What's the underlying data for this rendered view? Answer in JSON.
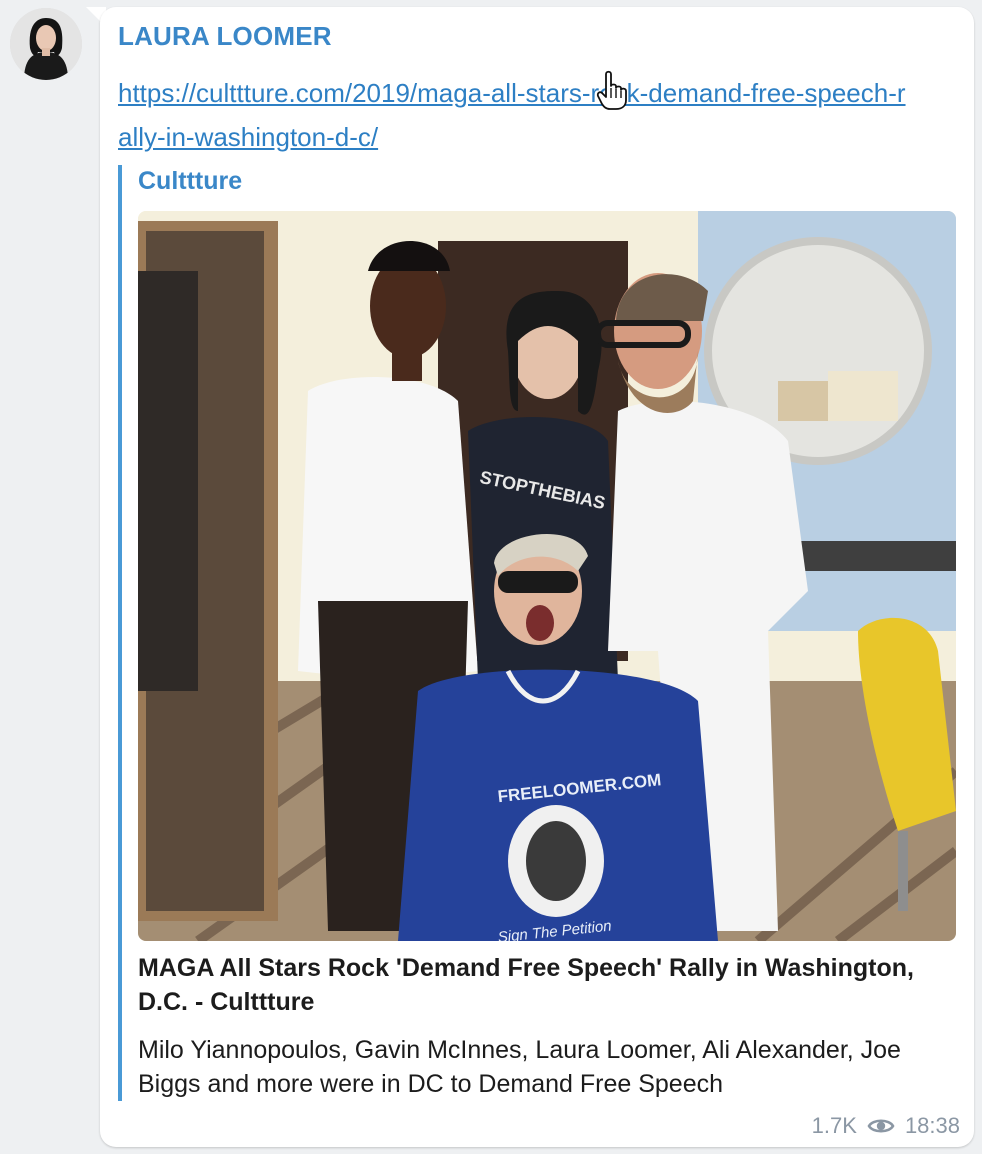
{
  "message": {
    "sender": "LAURA LOOMER",
    "link": "https://culttture.com/2019/maga-all-stars-rock-demand-free-speech-rally-in-washington-d-c/",
    "preview": {
      "site_name": "Culttture",
      "title": "MAGA All Stars Rock 'Demand Free Speech' Rally in Washington, D.C. - Culttture",
      "description": "Milo Yiannopoulos, Gavin McInnes, Laura Loomer, Ali Alexander, Joe Biggs and more were in DC to Demand Free Speech",
      "shirt_text_1": "STOPTHEBIAS",
      "shirt_text_2": "FREELOOMER.COM",
      "shirt_text_3": "Sign The Petition"
    },
    "views": "1.7K",
    "time": "18:38"
  },
  "icons": [
    "avatar",
    "eye-icon",
    "hand-pointer-icon"
  ],
  "colors": {
    "accent": "#3a87c8",
    "link": "#2d7fc4",
    "preview_bar": "#4a9ad6",
    "meta": "#8b97a4",
    "background": "#eef0f2"
  }
}
